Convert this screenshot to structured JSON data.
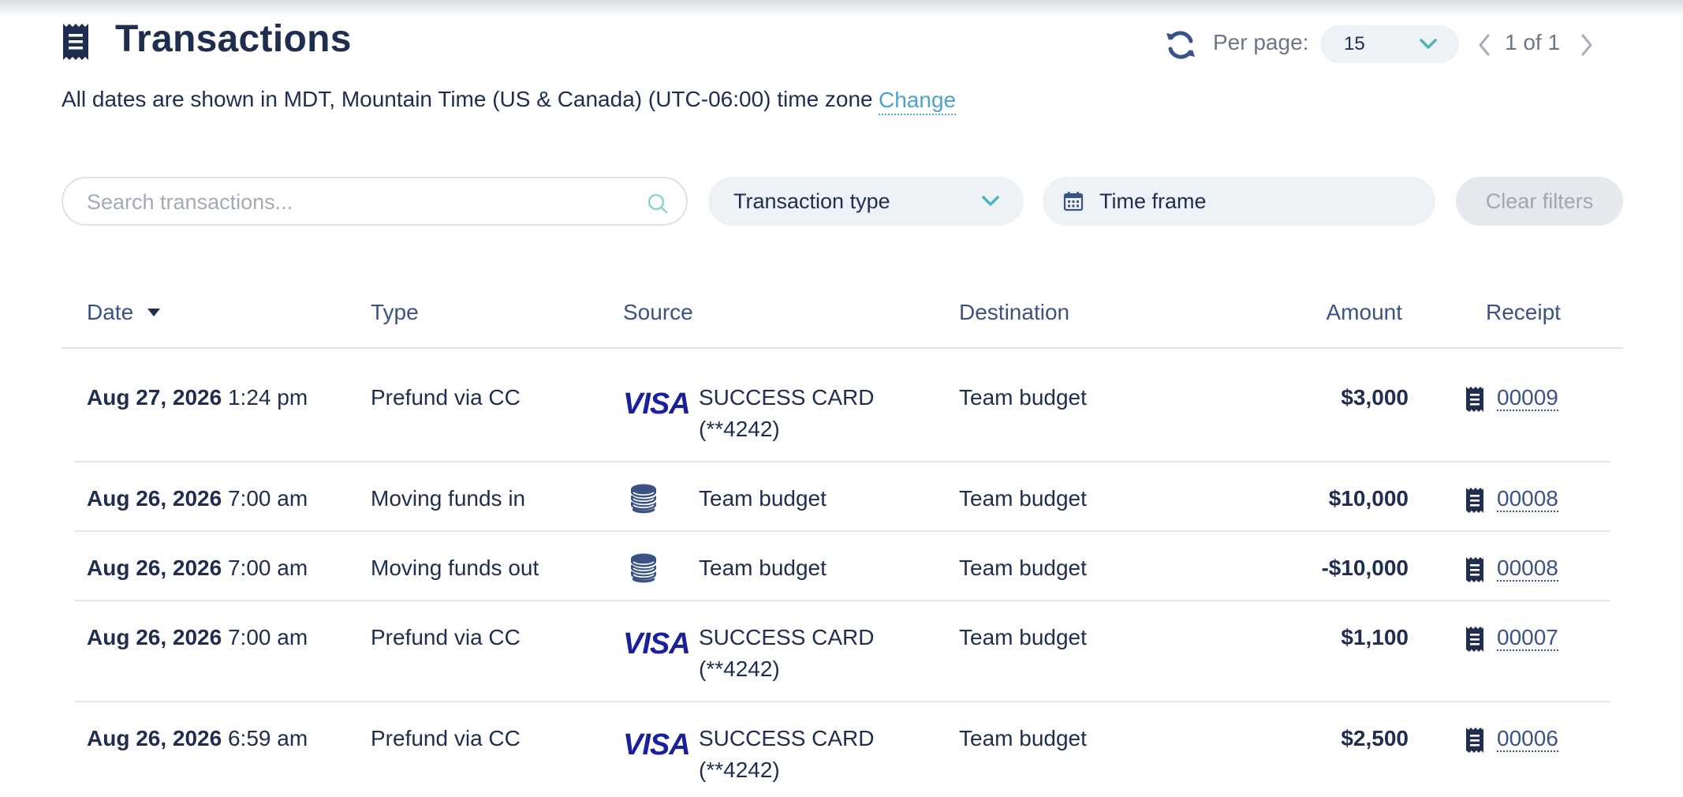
{
  "header": {
    "title": "Transactions",
    "title_icon": "receipt-icon",
    "refresh_icon": "refresh-icon",
    "per_page_label": "Per page:",
    "per_page_value": "15",
    "page_indicator": "1 of 1"
  },
  "timezone": {
    "text": "All dates are shown in MDT, Mountain Time (US & Canada) (UTC-06:00) time zone",
    "change_label": "Change"
  },
  "filters": {
    "search_placeholder": "Search transactions...",
    "search_value": "",
    "transaction_type_label": "Transaction type",
    "time_frame_label": "Time frame",
    "clear_filters_label": "Clear filters"
  },
  "table": {
    "columns": {
      "date": "Date",
      "type": "Type",
      "source": "Source",
      "destination": "Destination",
      "amount": "Amount",
      "receipt": "Receipt"
    },
    "sort": {
      "column": "date",
      "direction": "desc"
    },
    "rows": [
      {
        "date": "Aug 27, 2026",
        "time": "1:24 pm",
        "type": "Prefund via CC",
        "source_icon": "visa-logo",
        "source_line1": "SUCCESS CARD",
        "source_line2": "(**4242)",
        "destination": "Team budget",
        "amount": "$3,000",
        "receipt": "00009"
      },
      {
        "date": "Aug 26, 2026",
        "time": "7:00 am",
        "type": "Moving funds in",
        "source_icon": "coins-icon",
        "source_line1": "Team budget",
        "source_line2": "",
        "destination": "Team budget",
        "amount": "$10,000",
        "receipt": "00008"
      },
      {
        "date": "Aug 26, 2026",
        "time": "7:00 am",
        "type": "Moving funds out",
        "source_icon": "coins-icon",
        "source_line1": "Team budget",
        "source_line2": "",
        "destination": "Team budget",
        "amount": "-$10,000",
        "receipt": "00008"
      },
      {
        "date": "Aug 26, 2026",
        "time": "7:00 am",
        "type": "Prefund via CC",
        "source_icon": "visa-logo",
        "source_line1": "SUCCESS CARD",
        "source_line2": "(**4242)",
        "destination": "Team budget",
        "amount": "$1,100",
        "receipt": "00007"
      },
      {
        "date": "Aug 26, 2026",
        "time": "6:59 am",
        "type": "Prefund via CC",
        "source_icon": "visa-logo",
        "source_line1": "SUCCESS CARD",
        "source_line2": "(**4242)",
        "destination": "Team budget",
        "amount": "$2,500",
        "receipt": "00006"
      }
    ]
  },
  "colors": {
    "primary_text": "#1f2d4e",
    "header_text": "#3b5285",
    "link": "#4aa3d0",
    "accent": "#4fb3b8",
    "pill_bg": "#edf2f6",
    "visa_blue": "#1a1f9c"
  }
}
